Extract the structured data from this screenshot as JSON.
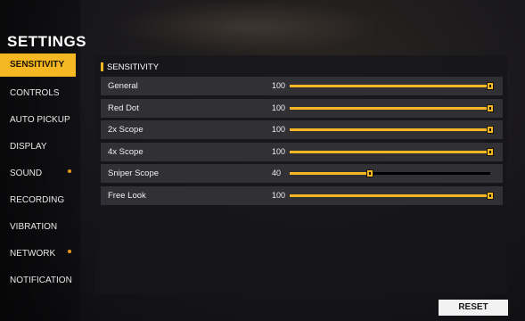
{
  "sidebar": {
    "title": "SETTINGS",
    "items": [
      {
        "label": "SENSITIVITY",
        "active": true,
        "dot": false
      },
      {
        "label": "CONTROLS",
        "active": false,
        "dot": false
      },
      {
        "label": "AUTO PICKUP",
        "active": false,
        "dot": false
      },
      {
        "label": "DISPLAY",
        "active": false,
        "dot": false
      },
      {
        "label": "SOUND",
        "active": false,
        "dot": true
      },
      {
        "label": "RECORDING",
        "active": false,
        "dot": false
      },
      {
        "label": "VIBRATION",
        "active": false,
        "dot": false
      },
      {
        "label": "NETWORK",
        "active": false,
        "dot": true
      },
      {
        "label": "NOTIFICATION",
        "active": false,
        "dot": false
      }
    ]
  },
  "panel": {
    "title": "SENSITIVITY",
    "rows": [
      {
        "label": "General",
        "value": "100",
        "level": 1.0
      },
      {
        "label": "Red Dot",
        "value": "100",
        "level": 1.0
      },
      {
        "label": "2x Scope",
        "value": "100",
        "level": 1.0
      },
      {
        "label": "4x Scope",
        "value": "100",
        "level": 1.0
      },
      {
        "label": "Sniper Scope",
        "value": "40",
        "level": 0.4
      },
      {
        "label": "Free Look",
        "value": "100",
        "level": 1.0
      }
    ]
  },
  "footer": {
    "reset_label": "RESET"
  },
  "colors": {
    "accent": "#f6b822",
    "panel_bg": "#16161a",
    "row_bg": "#3a3a40"
  }
}
